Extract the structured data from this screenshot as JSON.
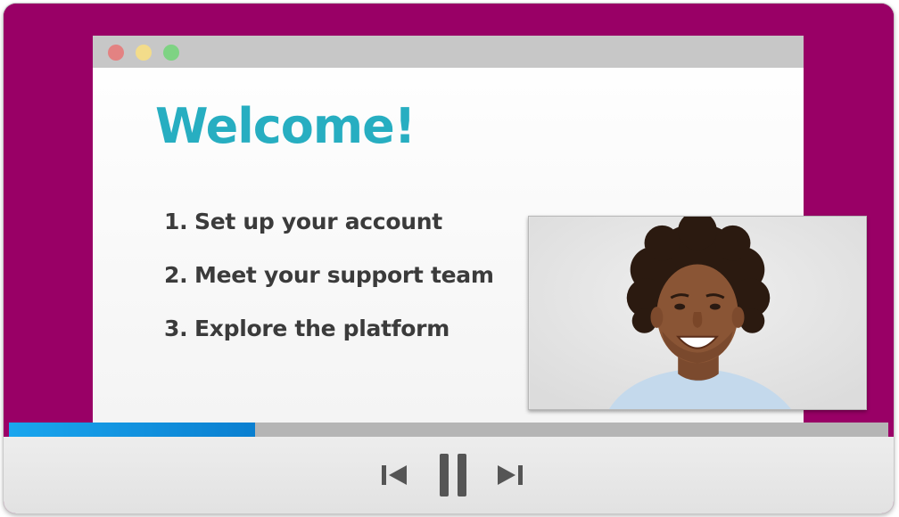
{
  "slide": {
    "title": "Welcome!",
    "agenda": [
      {
        "number": "1.",
        "text": "Set up your account"
      },
      {
        "number": "2.",
        "text": "Meet your support team"
      },
      {
        "number": "3.",
        "text": "Explore the platform"
      }
    ]
  },
  "webcam": {
    "subject": "smiling-presenter"
  },
  "playback": {
    "progress_fraction": 0.28,
    "state": "playing",
    "controls": [
      "previous-icon",
      "pause-icon",
      "next-icon"
    ]
  },
  "colors": {
    "background": "#990066",
    "title": "#27aec1",
    "progress": "#0a8ee0"
  }
}
